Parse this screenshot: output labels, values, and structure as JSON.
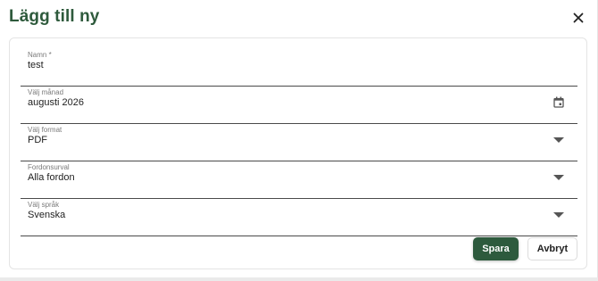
{
  "dialog": {
    "title": "Lägg till ny",
    "close_icon": "close-icon"
  },
  "form": {
    "name": {
      "label": "Namn *",
      "value": "test"
    },
    "month": {
      "label": "Välj månad",
      "value": "augusti 2026",
      "icon": "calendar-icon"
    },
    "format": {
      "label": "Välj format",
      "value": "PDF",
      "icon": "chevron-down-icon"
    },
    "vehicles": {
      "label": "Fordonsurval",
      "value": "Alla fordon",
      "icon": "chevron-down-icon"
    },
    "language": {
      "label": "Välj språk",
      "value": "Svenska",
      "icon": "chevron-down-icon"
    }
  },
  "actions": {
    "save_label": "Spara",
    "cancel_label": "Avbryt"
  },
  "colors": {
    "title": "#2e5a3c",
    "primary": "#2d5a3d"
  }
}
